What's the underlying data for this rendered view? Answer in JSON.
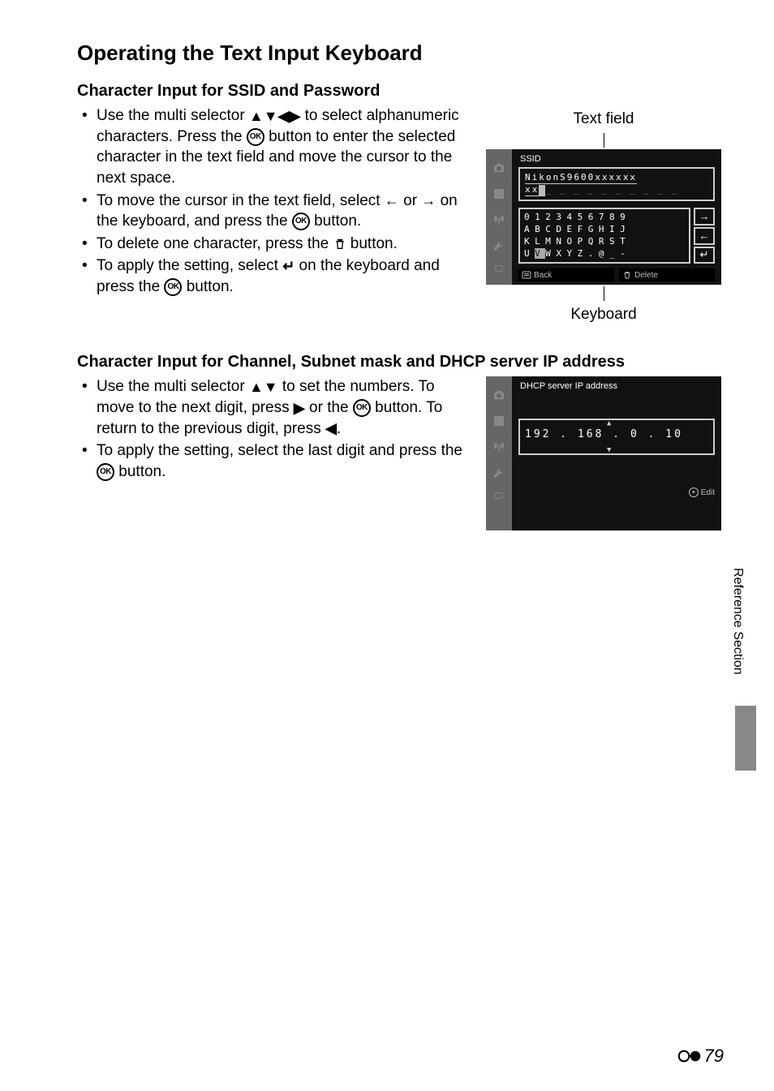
{
  "title": "Operating the Text Input Keyboard",
  "section1": {
    "heading": "Character Input for SSID and Password",
    "bullet1a": "Use the multi selector ",
    "bullet1b": " to select alphanumeric characters. Press the ",
    "bullet1c": " button to enter the selected character in the text field and move the cursor to the next space.",
    "bullet2a": "To move the cursor in the text field, select ",
    "bullet2b": " or ",
    "bullet2c": " on the keyboard, and press the ",
    "bullet2d": " button.",
    "bullet3a": "To delete one character, press the ",
    "bullet3b": " button.",
    "bullet4a": "To apply the setting, select ",
    "bullet4b": " on the keyboard and press the ",
    "bullet4c": " button.",
    "anno_top": "Text field",
    "anno_bottom": "Keyboard",
    "screen_title": "SSID",
    "textfield_value": "NikonS9600xxxxxx",
    "textfield_line2": "xx",
    "kb_row1": "0123456789",
    "kb_row2": "ABCDEFGHIJ",
    "kb_row3": "KLMNOPQRST",
    "kb_row4_pre": "U",
    "kb_row4_sel": "V",
    "kb_row4_post": "WXYZ.@_-",
    "btn_back": "Back",
    "btn_delete": "Delete"
  },
  "section2": {
    "heading": "Character Input for Channel, Subnet mask and DHCP server IP address",
    "bullet1a": "Use the multi selector ",
    "bullet1b": " to set the numbers. To move to the next digit, press ",
    "bullet1c": " or the ",
    "bullet1d": " button. To return to the previous digit, press ",
    "bullet1e": ".",
    "bullet2a": "To apply the setting, select the last digit and press the ",
    "bullet2b": " button.",
    "screen_title": "DHCP server IP address",
    "ip_seg1": "192",
    "ip_seg2": "168",
    "ip_seg3a": " ",
    "ip_seg3b": " ",
    "ip_seg3c": "0",
    "ip_seg4a": " ",
    "ip_seg4b": "1",
    "ip_seg4c": "0",
    "btn_edit": "Edit"
  },
  "side_label": "Reference Section",
  "page_number": "79"
}
